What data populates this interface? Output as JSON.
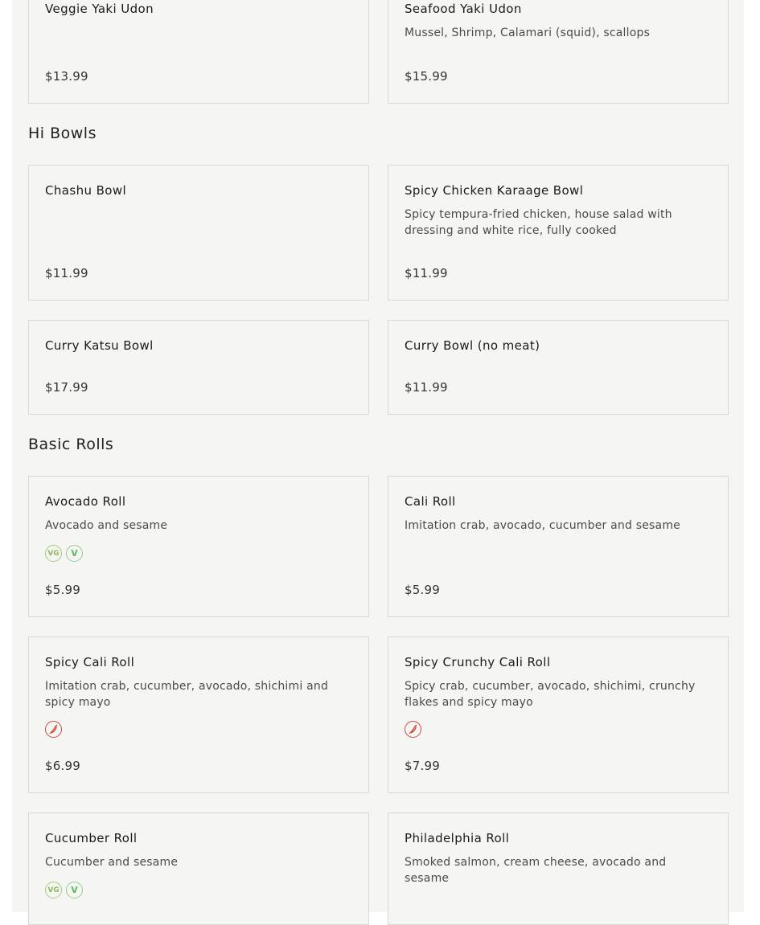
{
  "sections": [
    {
      "title": "Hi Bowls"
    },
    {
      "title": "Basic Rolls"
    }
  ],
  "items": [
    {
      "name": "Veggie Yaki Udon",
      "desc": "",
      "price": "$13.99"
    },
    {
      "name": "Seafood Yaki Udon",
      "desc": "Mussel, Shrimp, Calamari (squid), scallops",
      "price": "$15.99"
    },
    {
      "name": "Chashu Bowl",
      "desc": "",
      "price": "$11.99"
    },
    {
      "name": "Spicy Chicken Karaage Bowl",
      "desc": "Spicy tempura-fried chicken, house salad with dressing and white rice, fully cooked",
      "price": "$11.99"
    },
    {
      "name": "Curry Katsu Bowl",
      "desc": "",
      "price": "$17.99"
    },
    {
      "name": "Curry Bowl (no meat)",
      "desc": "",
      "price": "$11.99"
    },
    {
      "name": "Avocado Roll",
      "desc": "Avocado and sesame",
      "price": "$5.99",
      "badges": [
        "vegan",
        "vegetarian"
      ]
    },
    {
      "name": "Cali Roll",
      "desc": "Imitation crab, avocado, cucumber and sesame",
      "price": "$5.99"
    },
    {
      "name": "Spicy Cali Roll",
      "desc": "Imitation crab, cucumber, avocado, shichimi and spicy mayo",
      "price": "$6.99",
      "badges": [
        "spicy"
      ]
    },
    {
      "name": "Spicy Crunchy Cali Roll",
      "desc": "Spicy crab, cucumber, avocado, shichimi, crunchy flakes and spicy mayo",
      "price": "$7.99",
      "badges": [
        "spicy"
      ]
    },
    {
      "name": "Cucumber Roll",
      "desc": "Cucumber and sesame",
      "price": "",
      "badges": [
        "vegan",
        "vegetarian"
      ]
    },
    {
      "name": "Philadelphia Roll",
      "desc": "Smoked salmon, cream cheese, avocado and sesame",
      "price": ""
    }
  ],
  "badge_labels": {
    "vegan": "VG",
    "vegetarian": "V"
  },
  "colors": {
    "background": "#f5f6f3",
    "border": "#d7d9d4",
    "vegan": "#8fb85a",
    "vegetarian": "#5cb85c",
    "spicy": "#cc4a3c"
  }
}
